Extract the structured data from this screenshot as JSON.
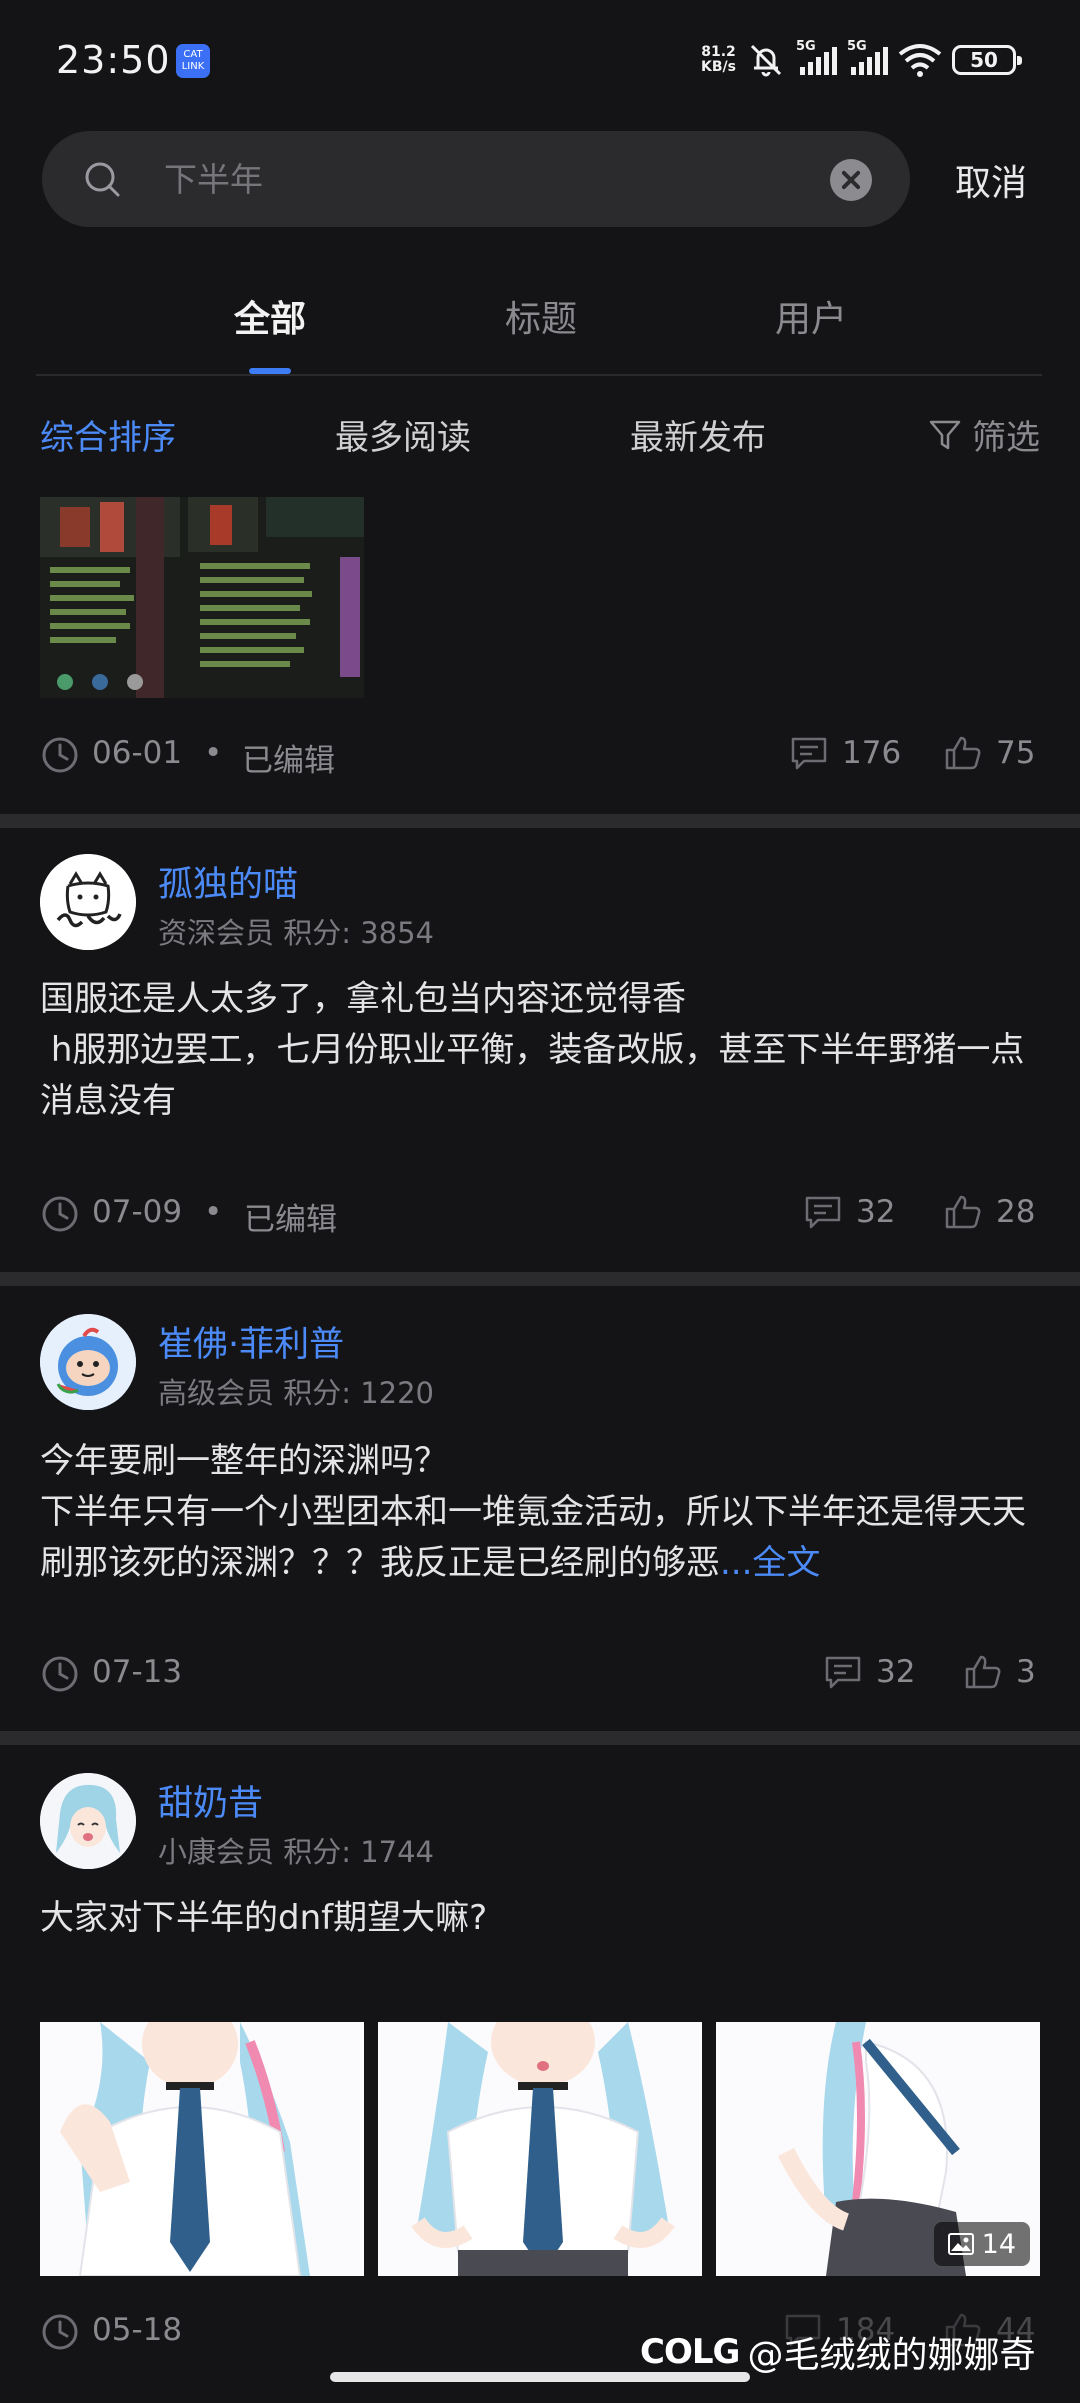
{
  "status_bar": {
    "time": "23:50",
    "catlink": "CAT LINK",
    "net_speed_value": "81.2",
    "net_speed_unit": "KB/s",
    "sim1": "5G",
    "sim2": "5G",
    "battery": "50"
  },
  "search": {
    "placeholder": "下半年",
    "cancel_label": "取消"
  },
  "tabs": [
    {
      "label": "全部",
      "active": true
    },
    {
      "label": "标题",
      "active": false
    },
    {
      "label": "用户",
      "active": false
    }
  ],
  "sort": {
    "options": [
      "综合排序",
      "最多阅读",
      "最新发布"
    ],
    "active_index": 0,
    "filter_label": "筛选"
  },
  "posts": [
    {
      "date": "06-01",
      "edited_label": "已编辑",
      "comments": "176",
      "likes": "75"
    },
    {
      "username": "孤独的喵",
      "rank": "资深会员 积分: 3854",
      "text": "国服还是人太多了，拿礼包当内容还觉得香\n h服那边罢工，七月份职业平衡，装备改版，甚至下半年野猪一点消息没有",
      "date": "07-09",
      "edited_label": "已编辑",
      "comments": "32",
      "likes": "28"
    },
    {
      "username": "崔佛·菲利普",
      "rank": "高级会员 积分: 1220",
      "text": "今年要刷一整年的深渊吗？\n下半年只有一个小型团本和一堆氪金活动，所以下半年还是得天天刷那该死的深渊？？？我反正是已经刷的够恶",
      "more_label": "...全文",
      "date": "07-13",
      "comments": "32",
      "likes": "3"
    },
    {
      "username": "甜奶昔",
      "rank": "小康会员 积分: 1744",
      "text": "大家对下半年的dnf期望大嘛?",
      "image_count": "14",
      "date": "05-18",
      "comments": "184",
      "likes": "44"
    }
  ],
  "watermark": {
    "logo": "COLG",
    "handle": "@毛绒绒的娜娜奇"
  },
  "colors": {
    "accent": "#4b8af7",
    "background": "#141416",
    "divider": "#2b2b2e"
  }
}
